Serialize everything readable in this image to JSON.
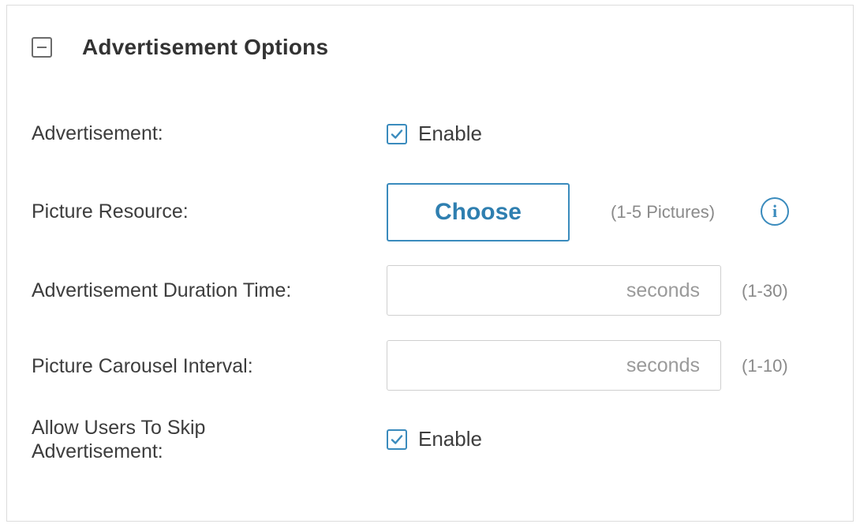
{
  "section": {
    "title": "Advertisement Options"
  },
  "rows": {
    "advertisement": {
      "label": "Advertisement:",
      "checkbox_label": "Enable",
      "checked": true
    },
    "picture_resource": {
      "label": "Picture Resource:",
      "button_label": "Choose",
      "hint": "(1-5 Pictures)",
      "info_glyph": "i"
    },
    "duration": {
      "label": "Advertisement Duration Time:",
      "value": "",
      "unit": "seconds",
      "range": "(1-30)"
    },
    "carousel": {
      "label": "Picture Carousel Interval:",
      "value": "",
      "unit": "seconds",
      "range": "(1-10)"
    },
    "skip": {
      "label_line1": "Allow Users To Skip",
      "label_line2": "Advertisement:",
      "checkbox_label": "Enable",
      "checked": true
    }
  },
  "colors": {
    "accent": "#3a8bbd",
    "text": "#3d3d3d",
    "hint": "#8a8a8a",
    "border": "#dcdcdc"
  },
  "icons": {
    "collapse": "minus-square-icon",
    "check": "checkmark-icon",
    "info": "info-circle-icon"
  }
}
